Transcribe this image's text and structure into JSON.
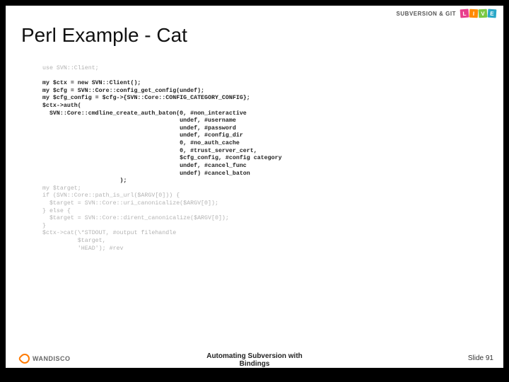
{
  "header": {
    "brand": "SUBVERSION & GIT",
    "live": [
      "L",
      "I",
      "V",
      "E"
    ]
  },
  "title": "Perl Example - Cat",
  "code": {
    "line_use": "use SVN::Client;",
    "l1": "my $ctx = new SVN::Client();",
    "l2": "my $cfg = SVN::Core::config_get_config(undef);",
    "l3": "my $cfg_config = $cfg->{SVN::Core::CONFIG_CATEGORY_CONFIG};",
    "l4": "$ctx->auth(",
    "l5": "  SVN::Core::cmdline_create_auth_baton(0, #non_interactive",
    "l6": "                                       undef, #username",
    "l7": "                                       undef, #password",
    "l8": "                                       undef, #config_dir",
    "l9": "                                       0, #no_auth_cache",
    "l10": "                                       0, #trust_server_cert,",
    "l11": "                                       $cfg_config, #config category",
    "l12": "                                       undef, #cancel_func",
    "l13": "                                       undef) #cancel_baton",
    "l14": "                      );",
    "g1": "my $target;",
    "g2": "if (SVN::Core::path_is_url($ARGV[0])) {",
    "g3": "  $target = SVN::Core::uri_canonicalize($ARGV[0]);",
    "g4": "} else {",
    "g5": "  $target = SVN::Core::dirent_canonicalize($ARGV[0]);",
    "g6": "}",
    "g7": "$ctx->cat(\\*STDOUT, #output filehandle",
    "g8": "          $target,",
    "g9": "          'HEAD'); #rev"
  },
  "footer": {
    "center1": "Automating Subversion with",
    "center2": "Bindings",
    "slide_label": "Slide 91",
    "wandisco": "WANDISCO"
  }
}
